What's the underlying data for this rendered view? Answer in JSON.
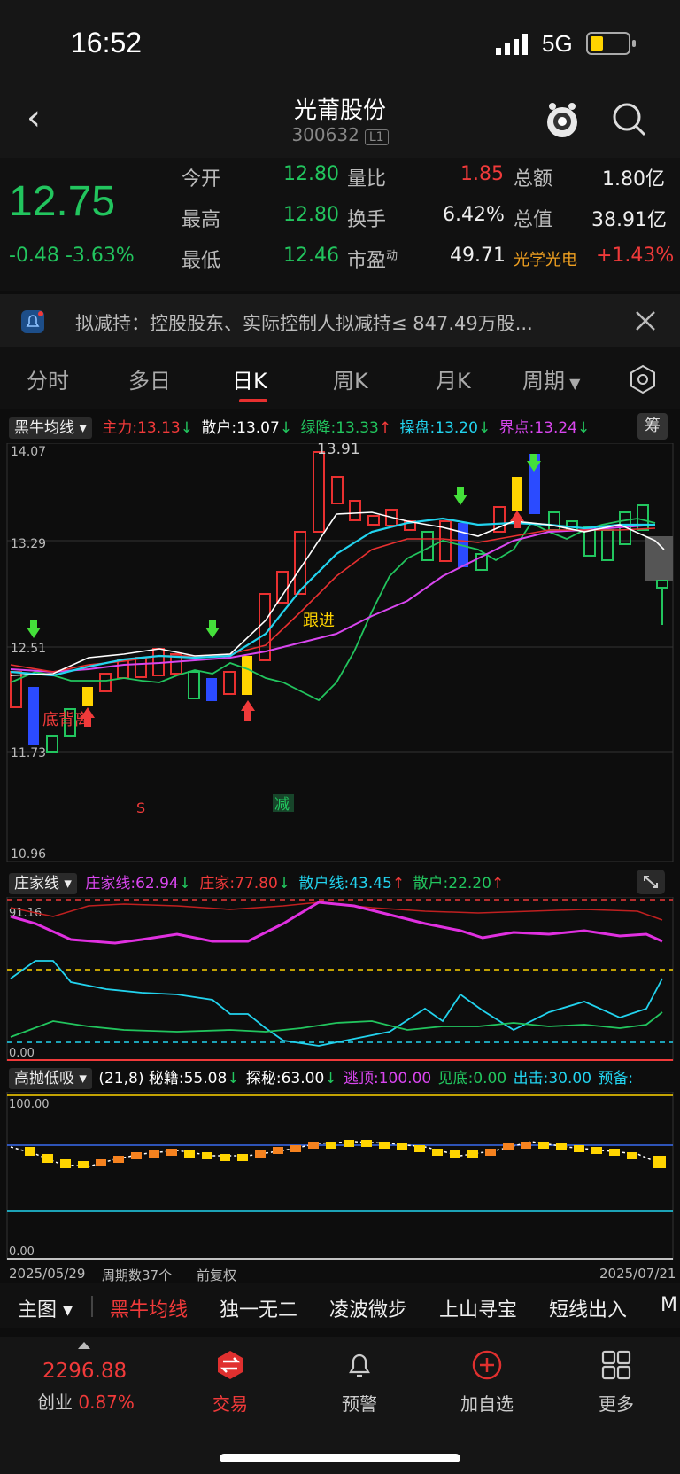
{
  "status_bar": {
    "time": "16:52",
    "network": "5G"
  },
  "header": {
    "title": "光莆股份",
    "code": "300632",
    "level": "L1"
  },
  "quote": {
    "price": "12.75",
    "change": "-0.48",
    "change_pct": "-3.63%",
    "rows": [
      {
        "l1": "今开",
        "v1": "12.80",
        "l2": "量比",
        "v2": "1.85",
        "l3": "总额",
        "v3": "1.80亿"
      },
      {
        "l1": "最高",
        "v1": "12.80",
        "l2": "换手",
        "v2": "6.42%",
        "l3": "总值",
        "v3": "38.91亿"
      },
      {
        "l1": "最低",
        "v1": "12.46",
        "l2": "市盈",
        "l2_sup": "动",
        "v2": "49.71",
        "l3": "光学光电",
        "v3": "+1.43%"
      }
    ]
  },
  "notice": {
    "text": "拟减持：控股股东、实际控制人拟减持≤ 847.49万股..."
  },
  "tabs": [
    "分时",
    "多日",
    "日K",
    "周K",
    "月K",
    "周期"
  ],
  "indicator1": {
    "selector": "黑牛均线",
    "items": [
      {
        "label": "主力:13.13",
        "arrow": "↓",
        "color": "#f03a3a"
      },
      {
        "label": "散户:13.07",
        "arrow": "↓",
        "color": "#ffffff"
      },
      {
        "label": "绿降:13.33",
        "arrow": "↑",
        "color": "#22c55e"
      },
      {
        "label": "操盘:13.20",
        "arrow": "↓",
        "color": "#22d3ee"
      },
      {
        "label": "界点:13.24",
        "arrow": "↓",
        "color": "#d946ef"
      }
    ],
    "right_btn": "筹"
  },
  "main_chart": {
    "y_labels": [
      "14.07",
      "13.29",
      "12.51",
      "11.73",
      "10.96"
    ],
    "high_label": "13.91",
    "annotations": {
      "follow": "跟进",
      "bottom_div": "底背离",
      "s": "S",
      "reduce": "减"
    }
  },
  "indicator2": {
    "selector": "庄家线",
    "items": [
      {
        "label": "庄家线:62.94",
        "arrow": "↓",
        "color": "#d946ef"
      },
      {
        "label": "庄家:77.80",
        "arrow": "↓",
        "color": "#f03a3a"
      },
      {
        "label": "散户线:43.45",
        "arrow": "↑",
        "color": "#22d3ee"
      },
      {
        "label": "散户:22.20",
        "arrow": "↑",
        "color": "#22c55e"
      }
    ],
    "y_top": "91.16",
    "y_bottom": "0.00"
  },
  "indicator3": {
    "selector": "高抛低吸",
    "items": [
      {
        "label": "(21,8) 秘籍:55.08",
        "arrow": "↓",
        "color": "#ffffff"
      },
      {
        "label": "探秘:63.00",
        "arrow": "↓",
        "color": "#ffffff"
      },
      {
        "label": "逃顶:100.00",
        "arrow": "",
        "color": "#d946ef"
      },
      {
        "label": "见底:0.00",
        "arrow": "",
        "color": "#22c55e"
      },
      {
        "label": "出击:30.00",
        "arrow": "",
        "color": "#22d3ee"
      },
      {
        "label": "预备:",
        "arrow": "",
        "color": "#22d3ee"
      }
    ],
    "y_top": "100.00",
    "y_bottom": "0.00"
  },
  "x_axis": {
    "start": "2025/05/29",
    "period_count": "周期数37个",
    "adjust": "前复权",
    "end": "2025/07/21"
  },
  "bottom_menu": [
    "主图",
    "黑牛均线",
    "独一无二",
    "凌波微步",
    "上山寻宝",
    "短线出入",
    "M"
  ],
  "nav": {
    "index_value": "2296.88",
    "index_name": "创业",
    "index_pct": "0.87%",
    "items": [
      "交易",
      "预警",
      "加自选",
      "更多"
    ]
  }
}
